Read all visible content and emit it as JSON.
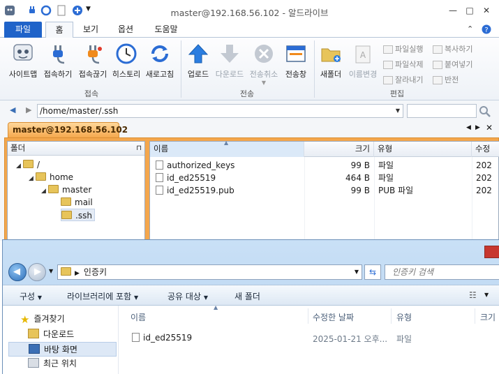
{
  "app": {
    "title": "master@192.168.56.102 - 알드라이브"
  },
  "ribbon_tabs": [
    "파일",
    "홈",
    "보기",
    "옵션",
    "도움말"
  ],
  "ribbon": {
    "connect_group": {
      "label": "접속",
      "buttons": [
        "사이트맵",
        "접속하기",
        "접속끊기",
        "히스토리",
        "새로고침"
      ]
    },
    "transfer_group": {
      "label": "전송",
      "buttons": [
        "업로드",
        "다운로드",
        "전송취소",
        "전송창"
      ]
    },
    "edit_group": {
      "label": "편집",
      "buttons": [
        "새폴더",
        "이름변경"
      ],
      "small": [
        "파일실행",
        "파일삭제",
        "잘라내기",
        "복사하기",
        "붙여넣기",
        "반전"
      ]
    }
  },
  "address": {
    "path": "/home/master/.ssh"
  },
  "session_tab": {
    "label": "master@192.168.56.102"
  },
  "tree": {
    "header": "폴더",
    "items": [
      {
        "label": "/",
        "level": 0
      },
      {
        "label": "home",
        "level": 1
      },
      {
        "label": "master",
        "level": 2
      },
      {
        "label": "mail",
        "level": 3
      },
      {
        "label": ".ssh",
        "level": 3
      }
    ]
  },
  "file_list": {
    "columns": [
      "이름",
      "크기",
      "유형",
      "수정"
    ],
    "rows": [
      {
        "name": "authorized_keys",
        "size": "99 B",
        "type": "파일",
        "date": "202"
      },
      {
        "name": "id_ed25519",
        "size": "464 B",
        "type": "파일",
        "date": "202"
      },
      {
        "name": "id_ed25519.pub",
        "size": "99 B",
        "type": "PUB 파일",
        "date": "202"
      }
    ]
  },
  "explorer": {
    "path": "인증키",
    "search_placeholder": "인증키 검색",
    "toolbar": [
      "구성",
      "라이브러리에 포함",
      "공유 대상",
      "새 폴더"
    ],
    "nav": [
      "즐겨찾기",
      "다운로드",
      "바탕 화면",
      "최근 위치"
    ],
    "columns": [
      "이름",
      "수정한 날짜",
      "유형",
      "크기"
    ],
    "rows": [
      {
        "name": "id_ed25519",
        "date": "2025-01-21 오후...",
        "type": "파일"
      }
    ]
  },
  "colors": {
    "accent": "#1f63c9",
    "session_tab": "#f5a64a"
  }
}
